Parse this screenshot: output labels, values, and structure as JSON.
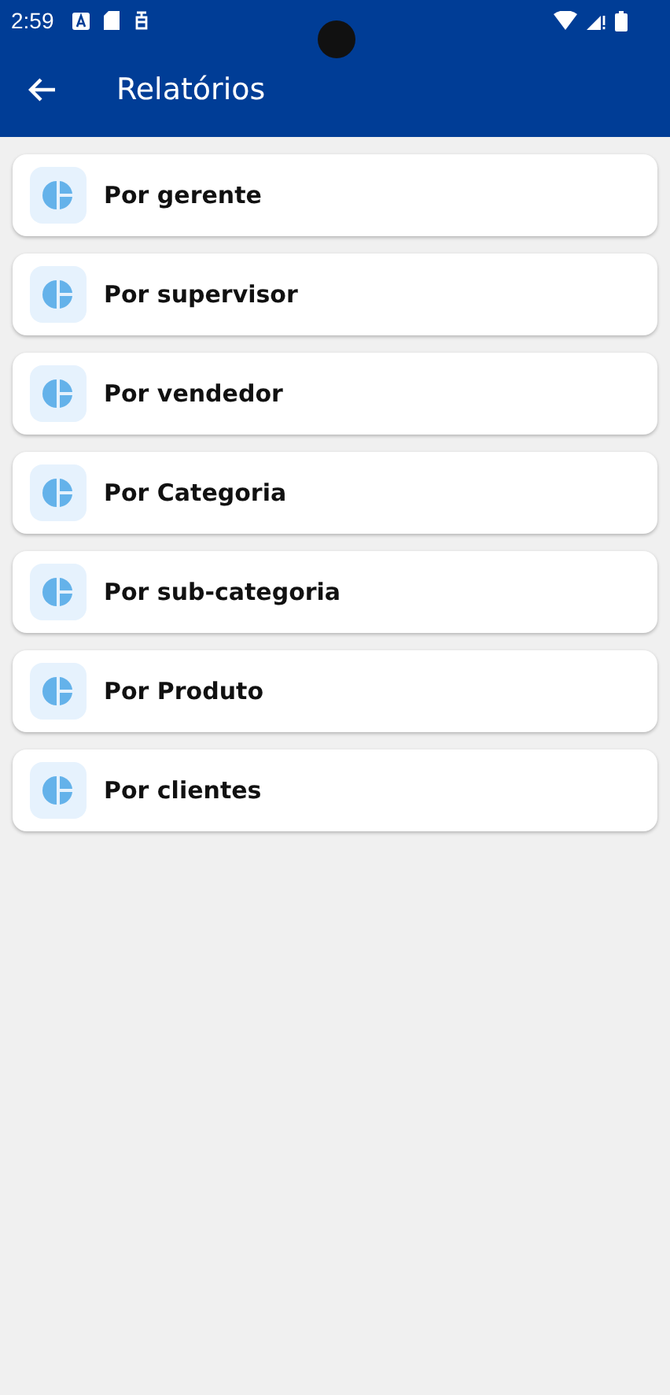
{
  "status_bar": {
    "time": "2:59"
  },
  "app_bar": {
    "title": "Relatórios"
  },
  "reports": [
    {
      "label": "Por gerente"
    },
    {
      "label": "Por supervisor"
    },
    {
      "label": "Por vendedor"
    },
    {
      "label": "Por Categoria"
    },
    {
      "label": "Por sub-categoria"
    },
    {
      "label": "Por Produto"
    },
    {
      "label": "Por clientes"
    }
  ]
}
